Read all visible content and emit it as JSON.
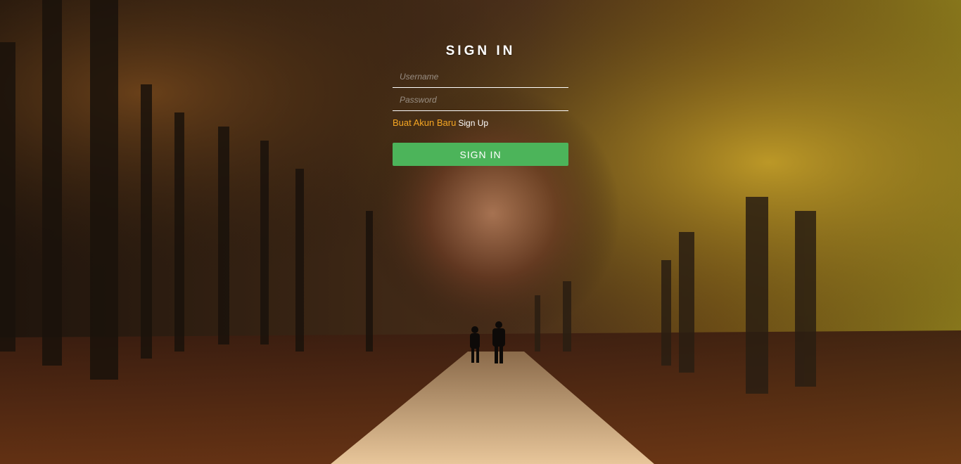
{
  "login": {
    "title": "SIGN IN",
    "username_placeholder": "Username",
    "password_placeholder": "Password",
    "signup_prompt": "Buat Akun Baru",
    "signup_link": "Sign Up",
    "submit_label": "SIGN IN"
  },
  "colors": {
    "accent_button": "#4cb45a",
    "signup_prompt": "#f5a623",
    "text": "#ffffff"
  },
  "background": {
    "icon": "autumn-forest-path-photo"
  }
}
